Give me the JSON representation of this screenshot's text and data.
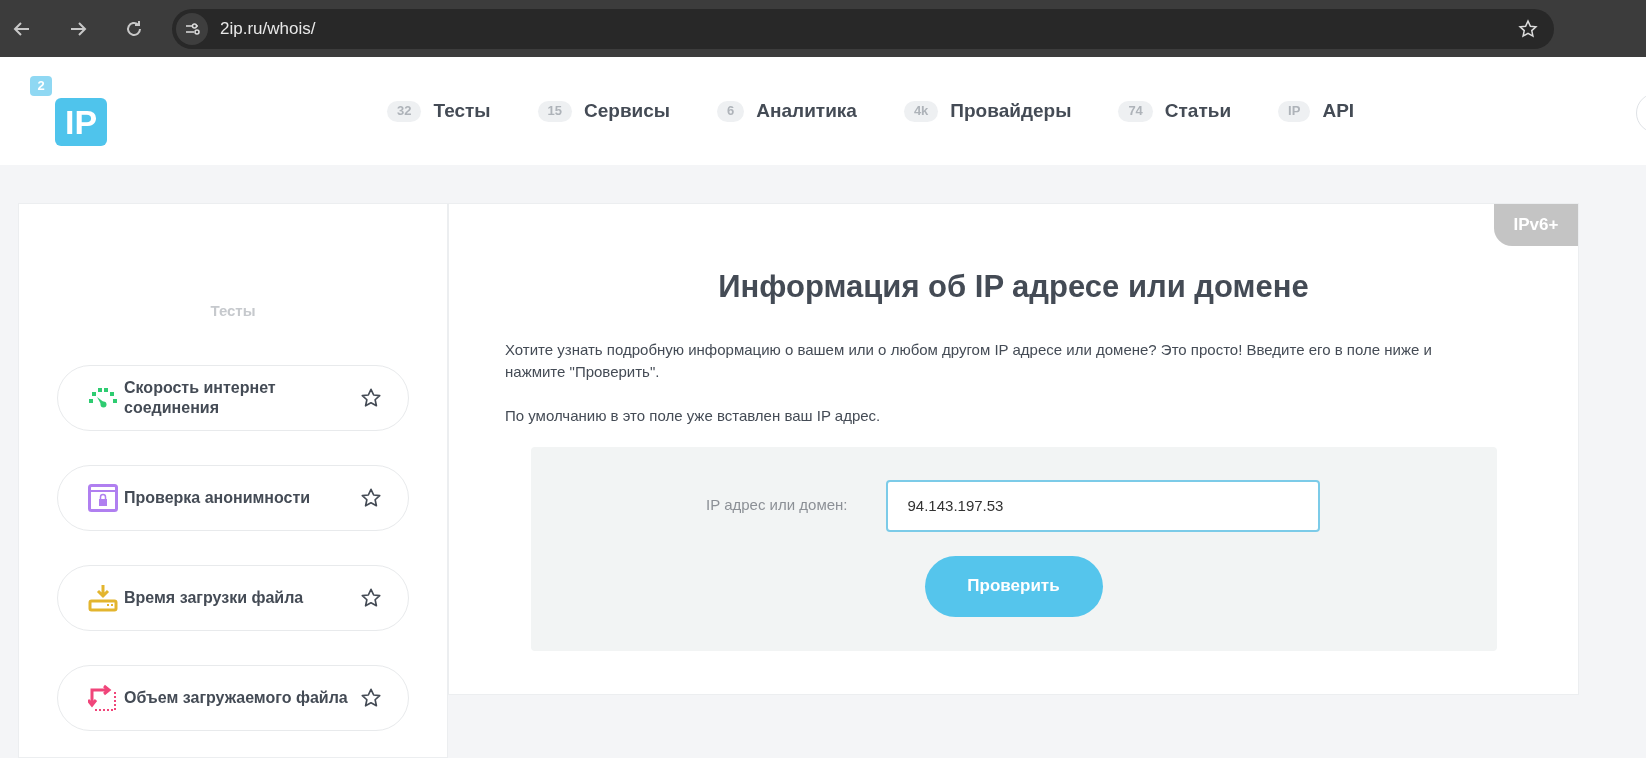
{
  "browser": {
    "url": "2ip.ru/whois/"
  },
  "logo": {
    "small": "2",
    "big": "IP"
  },
  "nav": [
    {
      "badge": "32",
      "label": "Тесты"
    },
    {
      "badge": "15",
      "label": "Сервисы"
    },
    {
      "badge": "6",
      "label": "Аналитика"
    },
    {
      "badge": "4k",
      "label": "Провайдеры"
    },
    {
      "badge": "74",
      "label": "Статьи"
    },
    {
      "badge": "IP",
      "label": "API"
    }
  ],
  "sidebar": {
    "title": "Тесты",
    "items": [
      {
        "kind": "speed",
        "label": "Скорость интернет соединения"
      },
      {
        "kind": "anon",
        "label": "Проверка анонимности"
      },
      {
        "kind": "download",
        "label": "Время загрузки файла"
      },
      {
        "kind": "size",
        "label": "Объем загружаемого файла"
      }
    ]
  },
  "main": {
    "corner_tag": "IPv6+",
    "title": "Информация об IP адресе или домене",
    "paragraphs": [
      "Хотите узнать подробную информацию о вашем или о любом другом IP адресе или домене? Это просто! Введите его в поле ниже и нажмите \"Проверить\".",
      "По умолчанию в это поле уже вставлен ваш IP адрес."
    ],
    "form": {
      "label": "IP адрес или домен:",
      "value": "94.143.197.53",
      "button": "Проверить"
    }
  }
}
